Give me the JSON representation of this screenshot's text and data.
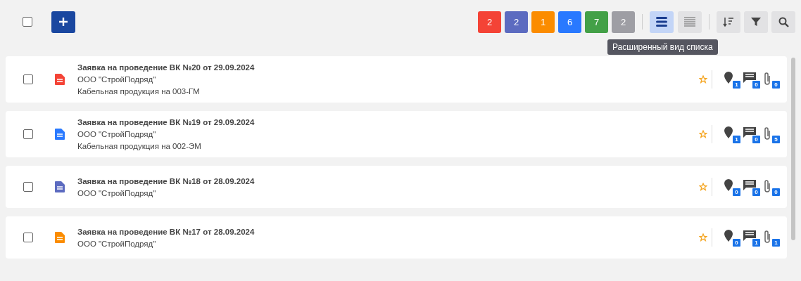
{
  "toolbar": {
    "select_all": {
      "checked": false
    },
    "counters": [
      {
        "count": "2",
        "color": "#f44336"
      },
      {
        "count": "2",
        "color": "#5c6bc0"
      },
      {
        "count": "1",
        "color": "#fb8c00"
      },
      {
        "count": "6",
        "color": "#2979ff"
      },
      {
        "count": "7",
        "color": "#43a047"
      },
      {
        "count": "2",
        "color": "#9e9ea4"
      }
    ],
    "view_modes": [
      {
        "kind": "extended",
        "selected": true
      },
      {
        "kind": "compact",
        "selected": false
      }
    ],
    "tooltip": "Расширенный вид списка"
  },
  "items": [
    {
      "checked": false,
      "color": "#f44336",
      "title": "Заявка на проведение ВК №20 от 29.09.2024",
      "org": "ООО \"СтройПодряд\"",
      "description": "Кабельная продукция на 003-ГМ",
      "locations": "1",
      "comments": "0",
      "attachments": "0"
    },
    {
      "checked": false,
      "color": "#2979ff",
      "title": "Заявка на проведение ВК №19 от 29.09.2024",
      "org": "ООО \"СтройПодряд\"",
      "description": "Кабельная продукция на 002-ЭМ",
      "locations": "1",
      "comments": "0",
      "attachments": "5"
    },
    {
      "checked": false,
      "color": "#5c6bc0",
      "title": "Заявка на проведение ВК №18 от 28.09.2024",
      "org": "ООО \"СтройПодряд\"",
      "locations": "0",
      "comments": "0",
      "attachments": "0"
    },
    {
      "checked": false,
      "color": "#fb8c00",
      "title": "Заявка на проведение ВК №17 от 28.09.2024",
      "org": "ООО \"СтройПодряд\"",
      "locations": "0",
      "comments": "1",
      "attachments": "1"
    }
  ]
}
